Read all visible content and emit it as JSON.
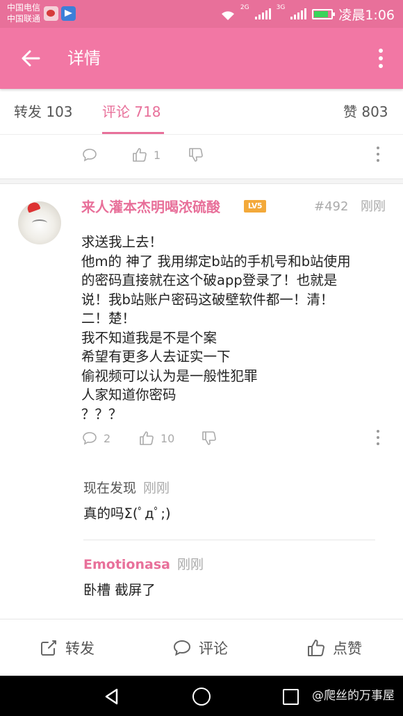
{
  "status_bar": {
    "carrier_1": "中国电信",
    "carrier_2": "中国联通",
    "net_1": "2G",
    "net_2": "3G",
    "time": "凌晨1:06"
  },
  "header": {
    "title": "详情"
  },
  "tabs": {
    "repost": "转发 103",
    "comments": "评论 718",
    "likes": "赞 803"
  },
  "prev_comment_actions": {
    "like_count": "1"
  },
  "comment": {
    "author": "来人灌本杰明喝浓硫酸",
    "level": "LV5",
    "floor": "#492",
    "time": "刚刚",
    "lines": [
      "求送我上去！",
      "他m的 神了 我用绑定b站的手机号和b站使用",
      "的密码直接就在这个破app登录了！也就是",
      "说！我b站账户密码这破壁软件都一！清！",
      "二！楚！",
      "我不知道我是不是个案",
      "希望有更多人去证实一下",
      "偷视频可以认为是一般性犯罪",
      "人家知道你密码",
      "？？？"
    ],
    "reply_count": "2",
    "like_count": "10"
  },
  "replies": [
    {
      "name": "现在发现",
      "time": "刚刚",
      "text": "真的吗Σ(ﾟдﾟ;)"
    },
    {
      "name": "Emotionasa",
      "time": "刚刚",
      "text": "卧槽 截屏了"
    }
  ],
  "bottom_bar": {
    "repost": "转发",
    "comment": "评论",
    "like": "点赞"
  },
  "watermark": "@爬丝的万事屋",
  "colors": {
    "accent": "#f277a4",
    "status_bar": "#e8709a",
    "level_badge": "#f3a93a"
  }
}
